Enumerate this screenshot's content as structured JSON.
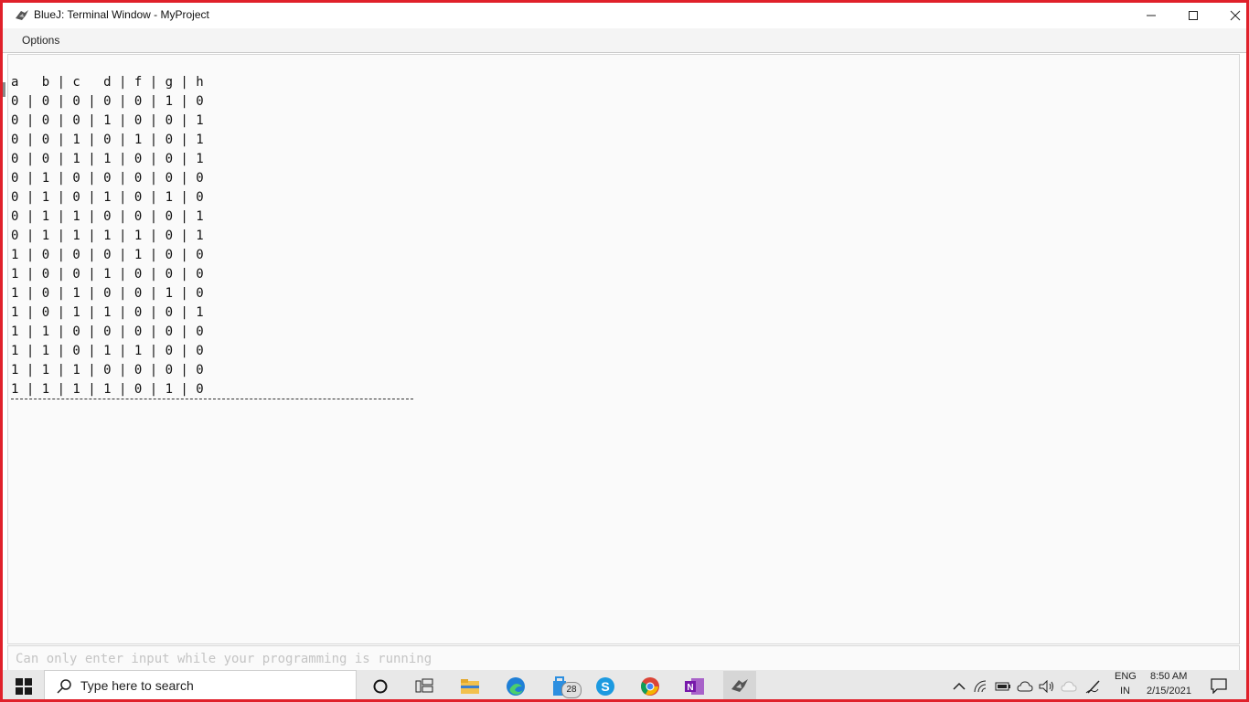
{
  "window": {
    "title": "BlueJ: Terminal Window - MyProject",
    "menu": [
      "Options"
    ]
  },
  "terminal": {
    "output_lines": [
      "a   b | c   d | f | g | h",
      "0 | 0 | 0 | 0 | 0 | 1 | 0",
      "0 | 0 | 0 | 1 | 0 | 0 | 1",
      "0 | 0 | 1 | 0 | 1 | 0 | 1",
      "0 | 0 | 1 | 1 | 0 | 0 | 1",
      "0 | 1 | 0 | 0 | 0 | 0 | 0",
      "0 | 1 | 0 | 1 | 0 | 1 | 0",
      "0 | 1 | 1 | 0 | 0 | 0 | 1",
      "0 | 1 | 1 | 1 | 1 | 0 | 1",
      "1 | 0 | 0 | 0 | 1 | 0 | 0",
      "1 | 0 | 0 | 1 | 0 | 0 | 0",
      "1 | 0 | 1 | 0 | 0 | 1 | 0",
      "1 | 0 | 1 | 1 | 0 | 0 | 1",
      "1 | 1 | 0 | 0 | 0 | 0 | 0",
      "1 | 1 | 0 | 1 | 1 | 0 | 0",
      "1 | 1 | 1 | 0 | 0 | 0 | 0",
      "1 | 1 | 1 | 1 | 0 | 1 | 0"
    ],
    "input_placeholder": "Can only enter input while your programming is running"
  },
  "taskbar": {
    "search_placeholder": "Type here to search",
    "apps": [
      "cortana-icon",
      "task-view-icon",
      "file-explorer-icon",
      "edge-icon",
      "store-icon",
      "skype-icon",
      "chrome-icon",
      "onenote-icon",
      "bluej-icon"
    ],
    "store_badge": "28",
    "language": "ENG",
    "region": "IN",
    "time": "8:50 AM",
    "date": "2/15/2021"
  },
  "colors": {
    "frame": "#e0202a",
    "terminal_bg": "#fafafa",
    "taskbar_bg": "#e8e8e8"
  }
}
